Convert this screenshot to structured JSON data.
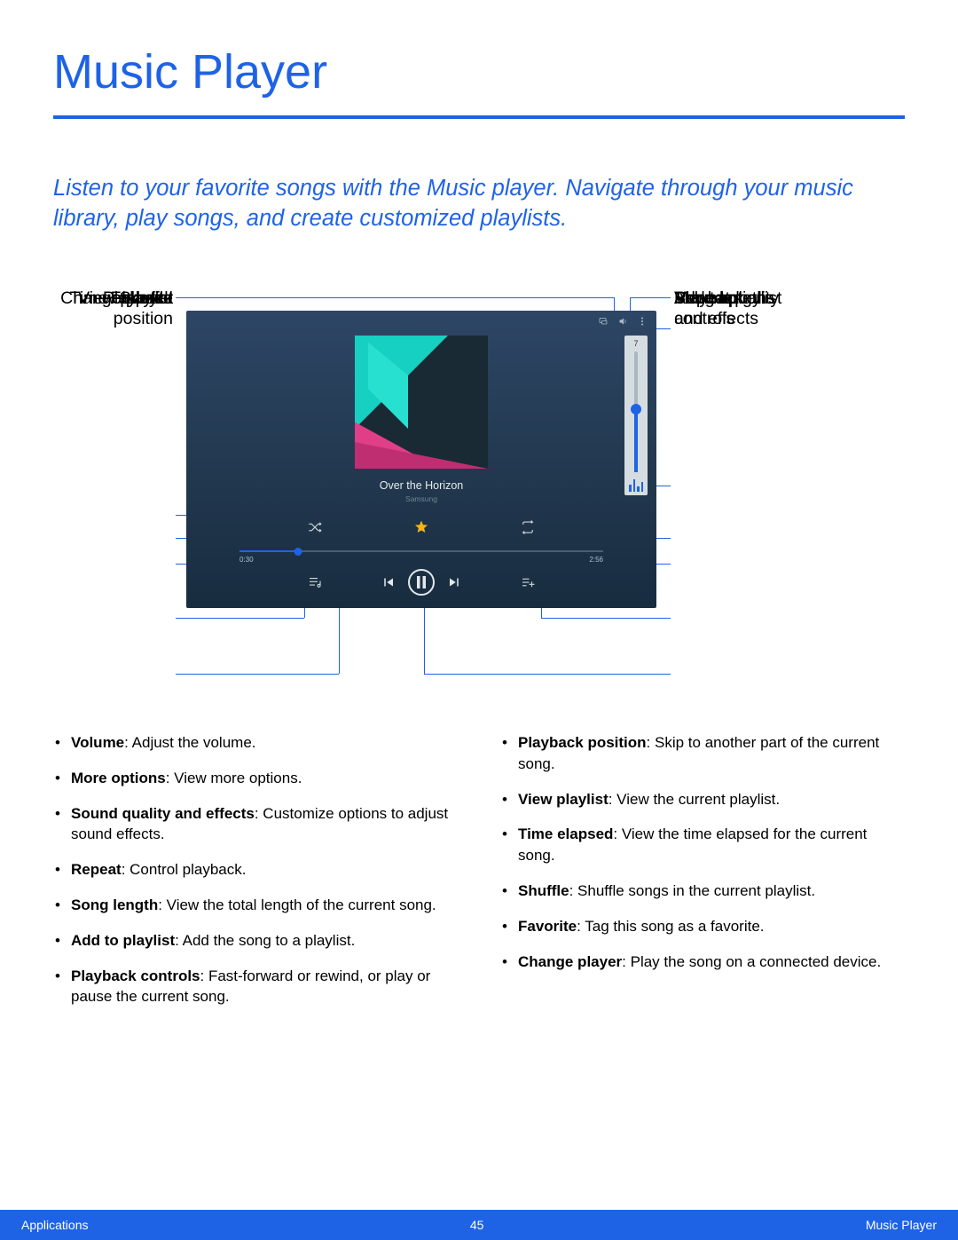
{
  "title": "Music Player",
  "intro": "Listen to your favorite songs with the Music player. Navigate through your music library, play songs, and create customized playlists.",
  "labels": {
    "change_player": "Change player",
    "favorite": "Favorite",
    "shuffle": "Shuffle",
    "time_elapsed": "Time elapsed",
    "view_playlist": "View playlist",
    "playback_position_l1": "Playback",
    "playback_position_l2": "position",
    "volume": "Volume",
    "more_options": "More options",
    "sound_quality_l1": "Sound quality",
    "sound_quality_l2": "and effects",
    "repeat": "Repeat",
    "song_length": "Song length",
    "add_to_playlist": "Add to playlist",
    "playback_controls_l1": "Playback",
    "playback_controls_l2": "controls"
  },
  "player": {
    "song_title": "Over the Horizon",
    "artist": "Samsung",
    "volume_level": "7",
    "time_elapsed": "0:30",
    "time_total": "2:56"
  },
  "bullets_left": [
    {
      "term": "Volume",
      "desc": ": Adjust the volume."
    },
    {
      "term": "More options",
      "desc": ": View more options."
    },
    {
      "term": "Sound quality and effects",
      "desc": ": Customize options to adjust sound effects."
    },
    {
      "term": "Repeat",
      "desc": ": Control playback."
    },
    {
      "term": "Song length",
      "desc": ": View the total length of the current song."
    },
    {
      "term": "Add to playlist",
      "desc": ": Add the song to a playlist."
    },
    {
      "term": "Playback controls",
      "desc": ": Fast-forward or rewind, or play or pause the current song."
    }
  ],
  "bullets_right": [
    {
      "term": "Playback position",
      "desc": ": Skip to another part of the current song."
    },
    {
      "term": "View playlist",
      "desc": ": View the current playlist."
    },
    {
      "term": "Time elapsed",
      "desc": ": View the time elapsed for the current song."
    },
    {
      "term": "Shuffle",
      "desc": ": Shuffle songs in the current playlist."
    },
    {
      "term": "Favorite",
      "desc": ": Tag this song as a favorite."
    },
    {
      "term": "Change player",
      "desc": ": Play the song on a connected device."
    }
  ],
  "footer": {
    "left": "Applications",
    "center": "45",
    "right": "Music Player"
  }
}
